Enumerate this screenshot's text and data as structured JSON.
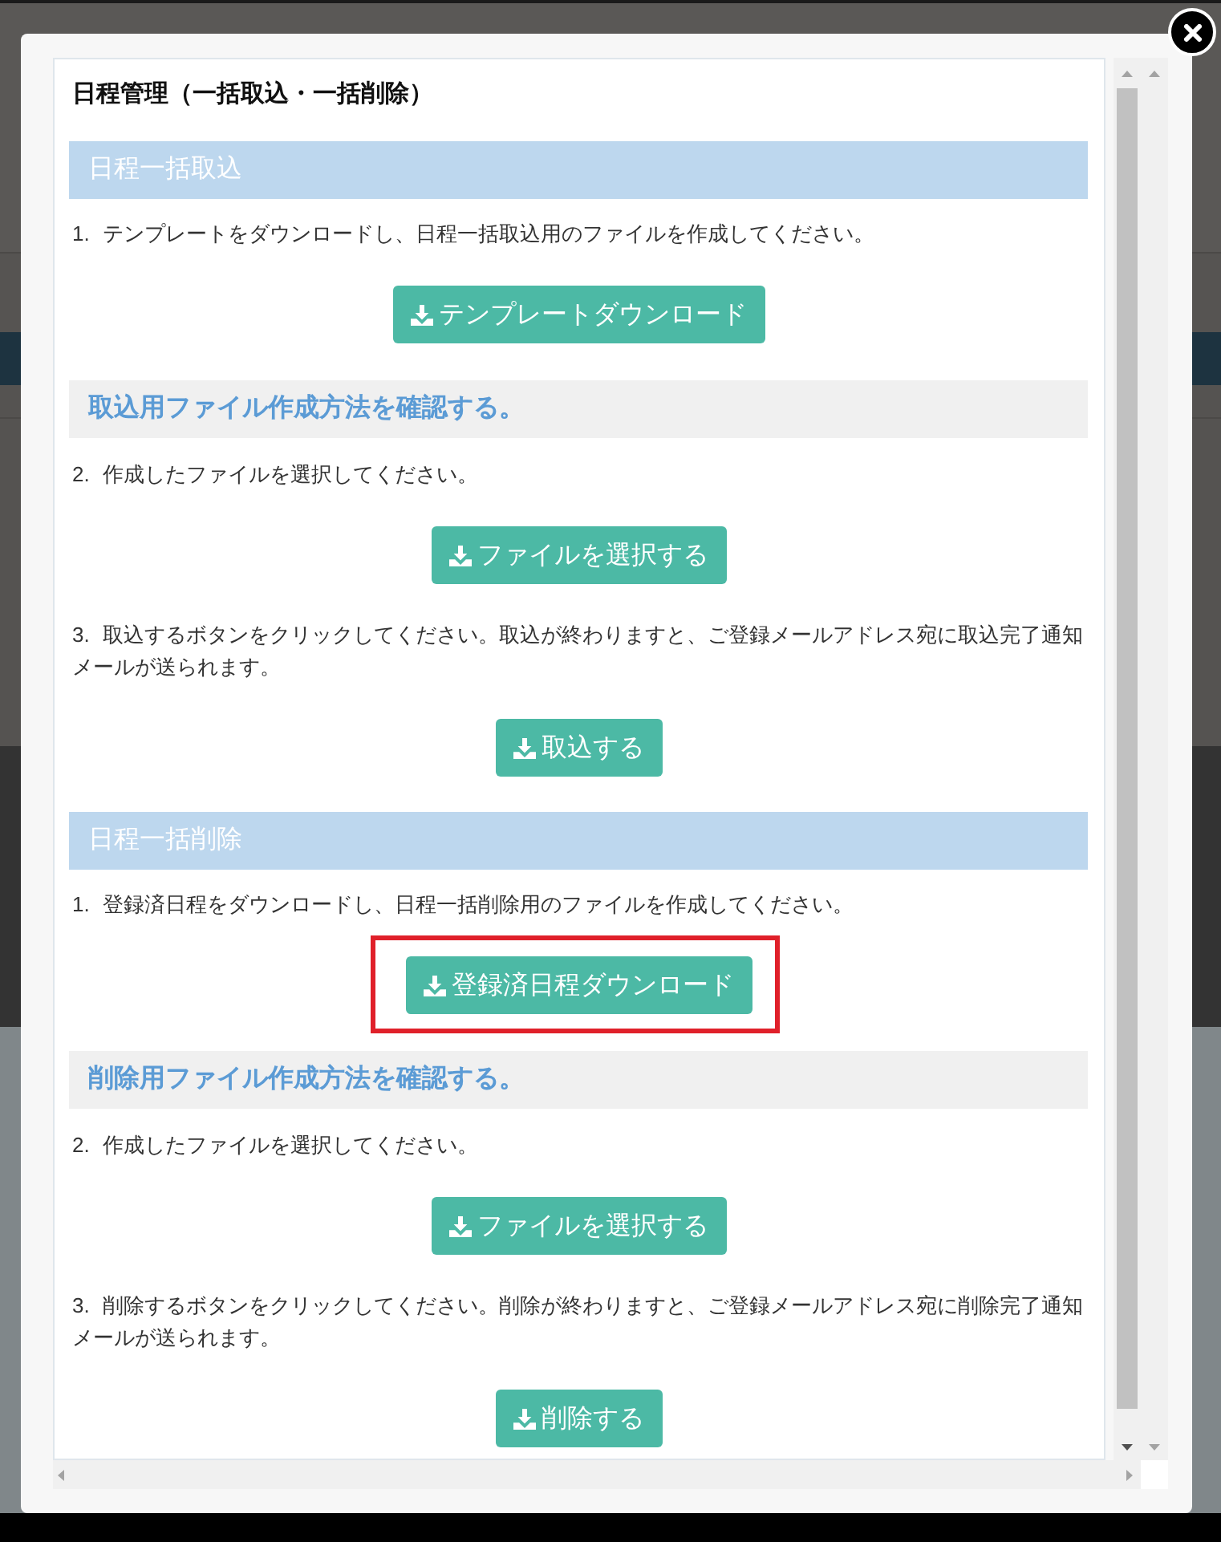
{
  "dialog": {
    "title": "日程管理（一括取込・一括削除）"
  },
  "sections": [
    {
      "heading": "日程一括取込",
      "items": [
        {
          "kind": "step",
          "number": "1.",
          "text": "テンプレートをダウンロードし、日程一括取込用のファイルを作成してください。"
        },
        {
          "kind": "button",
          "label": "テンプレートダウンロード",
          "highlighted": false
        },
        {
          "kind": "link",
          "label": "取込用ファイル作成方法を確認する。"
        },
        {
          "kind": "step",
          "number": "2.",
          "text": "作成したファイルを選択してください。"
        },
        {
          "kind": "button",
          "label": "ファイルを選択する",
          "highlighted": false
        },
        {
          "kind": "step",
          "number": "3.",
          "text": "取込するボタンをクリックしてください。取込が終わりますと、ご登録メールアドレス宛に取込完了通知メールが送られます。"
        },
        {
          "kind": "button",
          "label": "取込する",
          "highlighted": false
        }
      ]
    },
    {
      "heading": "日程一括削除",
      "items": [
        {
          "kind": "step",
          "number": "1.",
          "text": "登録済日程をダウンロードし、日程一括削除用のファイルを作成してください。"
        },
        {
          "kind": "button",
          "label": "登録済日程ダウンロード",
          "highlighted": true
        },
        {
          "kind": "link",
          "label": "削除用ファイル作成方法を確認する。"
        },
        {
          "kind": "step",
          "number": "2.",
          "text": "作成したファイルを選択してください。"
        },
        {
          "kind": "button",
          "label": "ファイルを選択する",
          "highlighted": false
        },
        {
          "kind": "step",
          "number": "3.",
          "text": "削除するボタンをクリックしてください。削除が終わりますと、ご登録メールアドレス宛に削除完了通知メールが送られます。"
        },
        {
          "kind": "button",
          "label": "削除する",
          "highlighted": false
        }
      ]
    }
  ]
}
